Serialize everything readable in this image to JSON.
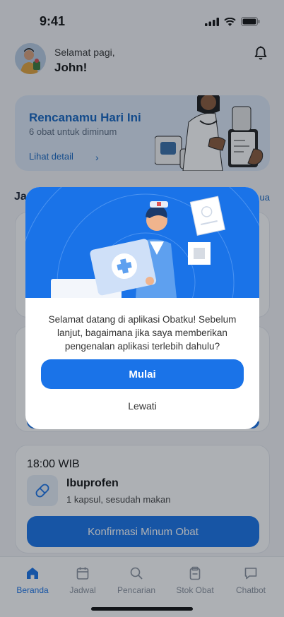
{
  "status_bar": {
    "time": "9:41"
  },
  "header": {
    "greeting": "Selamat pagi,",
    "user_name": "John!"
  },
  "plan_card": {
    "title": "Rencanamu Hari Ini",
    "subtitle": "6 obat untuk diminum",
    "link_label": "Lihat detail",
    "link_chevron": "›"
  },
  "schedule": {
    "section_title": "Ja",
    "see_all": "ua",
    "items": [
      {
        "time": "18:00 WIB",
        "medicine": "Ibuprofen",
        "dose": "1 kapsul, sesudah makan",
        "button": "Konfirmasi Minum Obat"
      }
    ]
  },
  "modal": {
    "message": "Selamat datang di aplikasi Obatku! Sebelum lanjut, bagaimana jika saya memberikan pengenalan aplikasi terlebih dahulu?",
    "primary_button": "Mulai",
    "secondary_button": "Lewati"
  },
  "nav": {
    "items": [
      {
        "label": "Beranda",
        "icon": "home-icon",
        "active": true
      },
      {
        "label": "Jadwal",
        "icon": "calendar-icon",
        "active": false
      },
      {
        "label": "Pencarian",
        "icon": "search-icon",
        "active": false
      },
      {
        "label": "Stok Obat",
        "icon": "medicine-box-icon",
        "active": false
      },
      {
        "label": "Chatbot",
        "icon": "chat-icon",
        "active": false
      }
    ]
  },
  "colors": {
    "primary": "#1a73e8",
    "accent_text": "#1565c0",
    "card_bg": "#dde9f8"
  }
}
